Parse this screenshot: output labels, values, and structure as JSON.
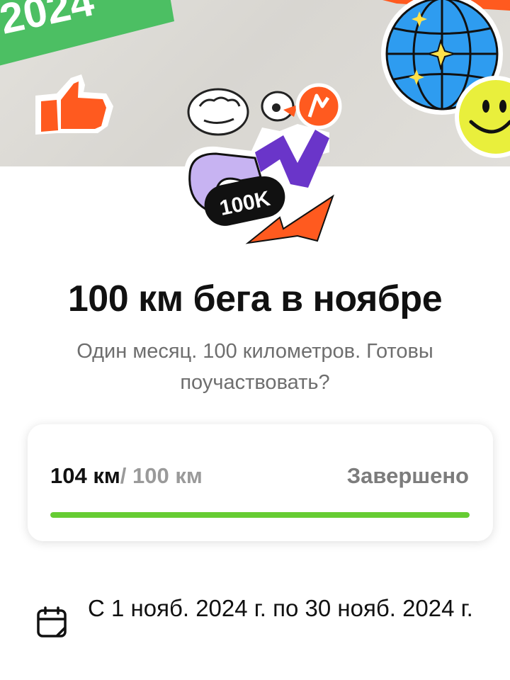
{
  "hero": {
    "year_sticker": "2024",
    "badge_text": "100K"
  },
  "challenge": {
    "title": "100 км бега в ноябре",
    "subtitle": "Один месяц. 100 километров. Готовы поучаствовать?"
  },
  "progress": {
    "current": "104 км",
    "separator": "/",
    "goal": "100 км",
    "status": "Завершено",
    "fraction": 1.0,
    "bar_color": "#66cc33"
  },
  "dates": {
    "icon": "calendar-icon",
    "text": "С 1 нояб. 2024 г. по 30 нояб. 2024 г."
  }
}
